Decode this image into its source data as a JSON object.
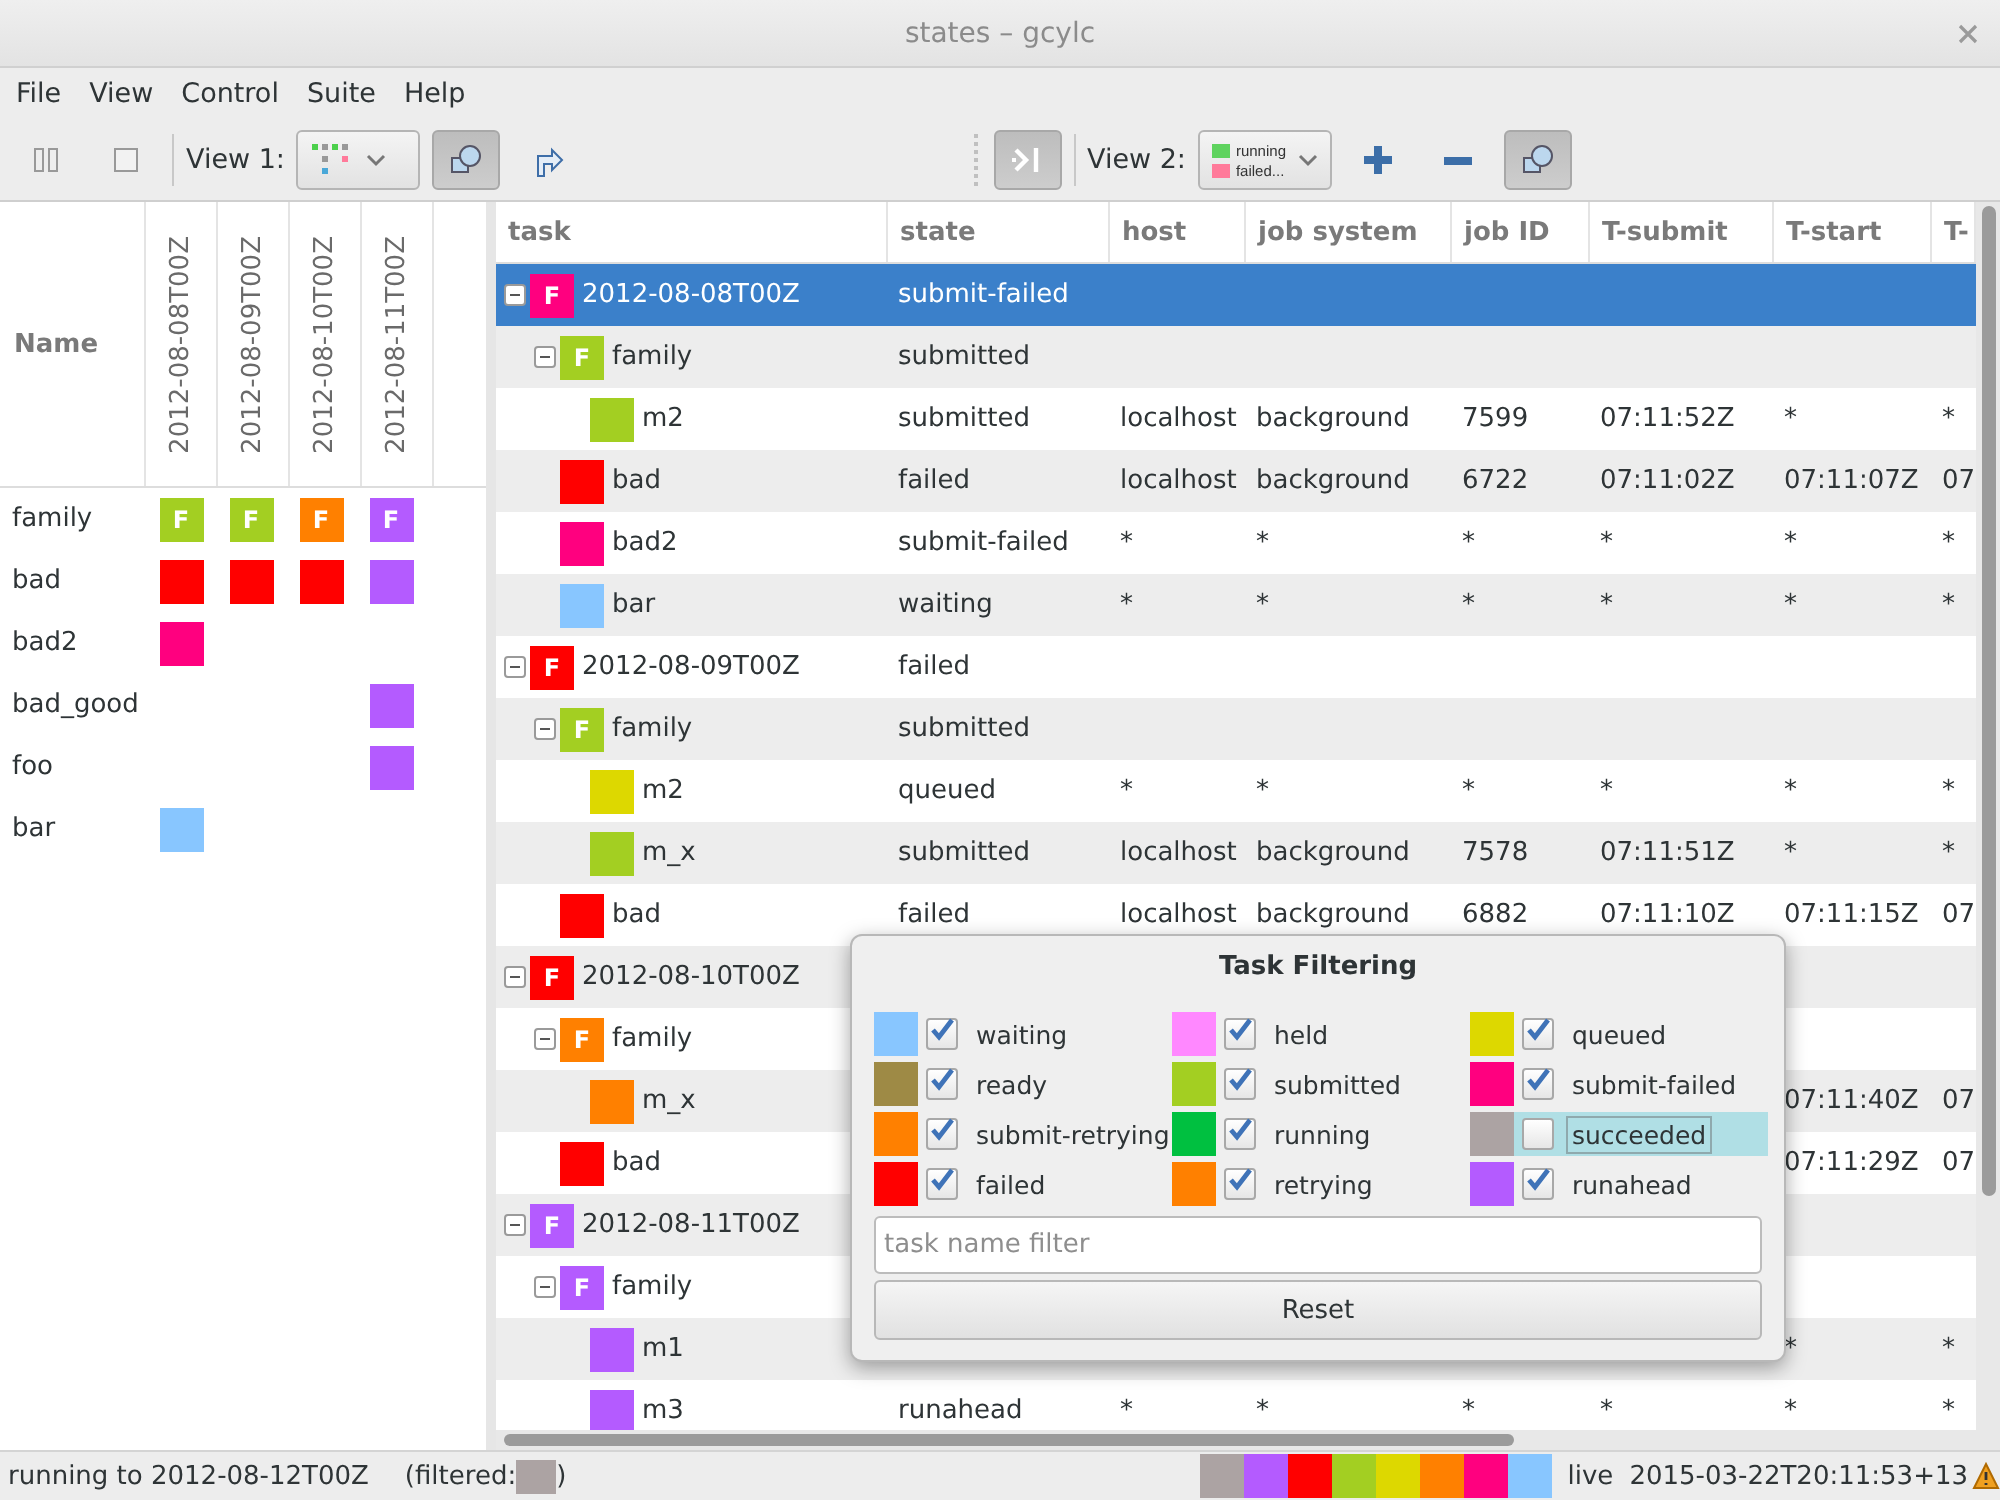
{
  "window": {
    "title": "states – gcylc"
  },
  "menu": [
    "File",
    "View",
    "Control",
    "Suite",
    "Help"
  ],
  "toolbar": {
    "view1": {
      "label": "View 1:",
      "filter_pressed": true
    },
    "group_toggle_pressed": true,
    "view2": {
      "label": "View 2:",
      "filter_pressed": true,
      "legend": [
        {
          "label": "running",
          "color": "#5fd35f"
        },
        {
          "label": "failed...",
          "color": "#ff7a9a"
        }
      ]
    }
  },
  "dot_view": {
    "name_header": "Name",
    "cycles": [
      "2012-08-08T00Z",
      "2012-08-09T00Z",
      "2012-08-10T00Z",
      "2012-08-11T00Z"
    ],
    "rows": [
      {
        "name": "family",
        "cells": [
          {
            "color": "#a3cf22",
            "label": "F"
          },
          {
            "color": "#a3cf22",
            "label": "F"
          },
          {
            "color": "#ff8000",
            "label": "F"
          },
          {
            "color": "#b45bff",
            "label": "F"
          }
        ]
      },
      {
        "name": "bad",
        "cells": [
          {
            "color": "#ff0000"
          },
          {
            "color": "#ff0000"
          },
          {
            "color": "#ff0000"
          },
          {
            "color": "#b45bff"
          }
        ]
      },
      {
        "name": "bad2",
        "cells": [
          {
            "color": "#ff007f"
          },
          null,
          null,
          null
        ]
      },
      {
        "name": "bad_good",
        "cells": [
          null,
          null,
          null,
          {
            "color": "#b45bff"
          }
        ]
      },
      {
        "name": "foo",
        "cells": [
          null,
          null,
          null,
          {
            "color": "#b45bff"
          }
        ]
      },
      {
        "name": "bar",
        "cells": [
          {
            "color": "#88c6ff"
          },
          null,
          null,
          null
        ]
      }
    ]
  },
  "tree": {
    "columns": [
      "task",
      "state",
      "host",
      "job system",
      "job ID",
      "T-submit",
      "T-start",
      "T-"
    ],
    "rows": [
      {
        "name": "2012-08-08T00Z",
        "label": "F",
        "color": "#ff007f",
        "state": "submit-failed",
        "selected": true,
        "expanded": true,
        "children": [
          {
            "name": "family",
            "label": "F",
            "color": "#a3cf22",
            "state": "submitted",
            "selected": false,
            "expanded": true,
            "children": [
              {
                "name": "m2",
                "color": "#a3cf22",
                "state": "submitted",
                "selected": false,
                "cells": [
                  "localhost",
                  "background",
                  "7599",
                  "07:11:52Z",
                  "*",
                  "*"
                ]
              }
            ]
          },
          {
            "name": "bad",
            "color": "#ff0000",
            "state": "failed",
            "selected": false,
            "cells": [
              "localhost",
              "background",
              "6722",
              "07:11:02Z",
              "07:11:07Z",
              "07"
            ]
          },
          {
            "name": "bad2",
            "color": "#ff007f",
            "state": "submit-failed",
            "selected": false,
            "cells": [
              "*",
              "*",
              "*",
              "*",
              "*",
              "*"
            ]
          },
          {
            "name": "bar",
            "color": "#88c6ff",
            "state": "waiting",
            "selected": false,
            "cells": [
              "*",
              "*",
              "*",
              "*",
              "*",
              "*"
            ]
          }
        ]
      },
      {
        "name": "2012-08-09T00Z",
        "label": "F",
        "color": "#ff0000",
        "state": "failed",
        "selected": false,
        "expanded": true,
        "children": [
          {
            "name": "family",
            "label": "F",
            "color": "#a3cf22",
            "state": "submitted",
            "selected": false,
            "expanded": true,
            "children": [
              {
                "name": "m2",
                "color": "#ddd800",
                "state": "queued",
                "selected": false,
                "cells": [
                  "*",
                  "*",
                  "*",
                  "*",
                  "*",
                  "*"
                ]
              },
              {
                "name": "m_x",
                "color": "#a3cf22",
                "state": "submitted",
                "selected": false,
                "cells": [
                  "localhost",
                  "background",
                  "7578",
                  "07:11:51Z",
                  "*",
                  "*"
                ]
              }
            ]
          },
          {
            "name": "bad",
            "color": "#ff0000",
            "state": "failed",
            "selected": false,
            "cells": [
              "localhost",
              "background",
              "6882",
              "07:11:10Z",
              "07:11:15Z",
              "07"
            ]
          }
        ]
      },
      {
        "name": "2012-08-10T00Z",
        "label": "F",
        "color": "#ff0000",
        "selected": false,
        "expanded": true,
        "children": [
          {
            "name": "family",
            "label": "F",
            "color": "#ff8000",
            "selected": false,
            "expanded": true,
            "children": [
              {
                "name": "m_x",
                "color": "#ff8000",
                "selected": false,
                "cells": [
                  null,
                  null,
                  null,
                  null,
                  "07:11:40Z",
                  "07"
                ]
              }
            ]
          },
          {
            "name": "bad",
            "color": "#ff0000",
            "selected": false,
            "cells": [
              null,
              null,
              null,
              null,
              "07:11:29Z",
              "07"
            ]
          }
        ]
      },
      {
        "name": "2012-08-11T00Z",
        "label": "F",
        "color": "#b45bff",
        "selected": false,
        "expanded": true,
        "children": [
          {
            "name": "family",
            "label": "F",
            "color": "#b45bff",
            "selected": false,
            "expanded": true,
            "children": [
              {
                "name": "m1",
                "color": "#b45bff",
                "selected": false,
                "cells": [
                  null,
                  null,
                  null,
                  null,
                  "*",
                  "*"
                ]
              },
              {
                "name": "m3",
                "color": "#b45bff",
                "state": "runahead",
                "selected": false,
                "cells": [
                  "*",
                  "*",
                  "*",
                  "*",
                  "*",
                  "*"
                ]
              }
            ]
          }
        ]
      }
    ]
  },
  "filter": {
    "title": "Task Filtering",
    "items": [
      {
        "label": "waiting",
        "color": "#88c6ff",
        "checked": true,
        "highlighted": false
      },
      {
        "label": "held",
        "color": "#ff88ff",
        "checked": true,
        "highlighted": false
      },
      {
        "label": "queued",
        "color": "#ddd800",
        "checked": true,
        "highlighted": false
      },
      {
        "label": "ready",
        "color": "#9e8a45",
        "checked": true,
        "highlighted": false
      },
      {
        "label": "submitted",
        "color": "#a3cf22",
        "checked": true,
        "highlighted": false
      },
      {
        "label": "submit-failed",
        "color": "#ff007f",
        "checked": true,
        "highlighted": false
      },
      {
        "label": "submit-retrying",
        "color": "#ff8000",
        "checked": true,
        "highlighted": false
      },
      {
        "label": "running",
        "color": "#00c040",
        "checked": true,
        "highlighted": false
      },
      {
        "label": "succeeded",
        "color": "#aca3a3",
        "checked": false,
        "highlighted": true
      },
      {
        "label": "failed",
        "color": "#ff0000",
        "checked": true,
        "highlighted": false
      },
      {
        "label": "retrying",
        "color": "#ff8000",
        "checked": true,
        "highlighted": false
      },
      {
        "label": "runahead",
        "color": "#b45bff",
        "checked": true,
        "highlighted": false
      }
    ],
    "search": {
      "placeholder": "task name filter"
    },
    "reset": "Reset"
  },
  "status_bar": {
    "run_text": "running to 2012-08-12T00Z",
    "filtered_open": "(filtered:",
    "filtered": [
      {
        "color": "#aca3a3"
      }
    ],
    "filtered_close": ")",
    "swatches": [
      {
        "color": "#aca3a3"
      },
      {
        "color": "#b45bff"
      },
      {
        "color": "#ff0000"
      },
      {
        "color": "#a3cf22"
      },
      {
        "color": "#ddd800"
      },
      {
        "color": "#ff8000"
      },
      {
        "color": "#ff007f"
      },
      {
        "color": "#88c6ff"
      }
    ],
    "mode": "live",
    "time": "2015-03-22T20:11:53+13",
    "warning": true
  }
}
